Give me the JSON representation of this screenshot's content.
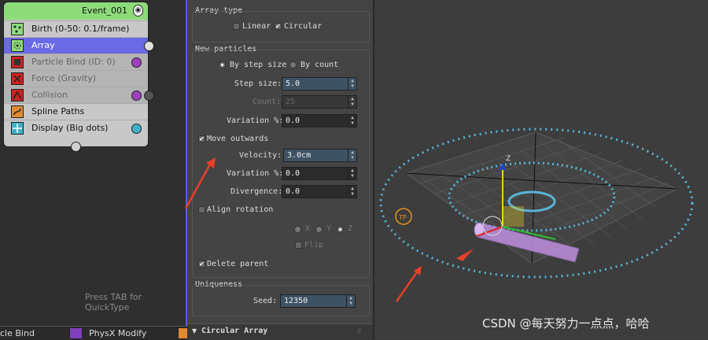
{
  "node": {
    "title": "Event_001",
    "rows": [
      {
        "label": "Birth (0-50: 0.1/frame)",
        "state": "normal",
        "pin": ""
      },
      {
        "label": "Array",
        "state": "selected",
        "pin": "#e0e0e0"
      },
      {
        "label": "Particle Bind (ID: 0)",
        "state": "disabled",
        "pin": "#a040c0"
      },
      {
        "label": "Force (Gravity)",
        "state": "disabled",
        "pin": ""
      },
      {
        "label": "Collision",
        "state": "disabled",
        "pin": "#a040c0"
      },
      {
        "label": "Spline Paths",
        "state": "normal",
        "pin": ""
      },
      {
        "label": "Display (Big dots)",
        "state": "normal",
        "pin": "#40b0c8"
      }
    ]
  },
  "graph": {
    "hint": "Press TAB for QuickType"
  },
  "bottombar": {
    "items": [
      "cle Bind",
      "PhysX Modify"
    ]
  },
  "panel": {
    "array_type": {
      "title": "Array type",
      "linear_label": "Linear",
      "linear_checked": false,
      "circular_label": "Circular",
      "circular_checked": true
    },
    "new_particles": {
      "title": "New particles",
      "by_step_size_label": "By step size",
      "by_count_label": "By count",
      "step_size_label": "Step size:",
      "step_size_value": "5.0",
      "count_label": "Count:",
      "count_value": "25",
      "variation1_label": "Variation %:",
      "variation1_value": "0.0",
      "move_outwards_label": "Move outwards",
      "move_outwards_checked": true,
      "velocity_label": "Velocity:",
      "velocity_value": "3.0cm",
      "variation2_label": "Variation %:",
      "variation2_value": "0.0",
      "divergence_label": "Divergence:",
      "divergence_value": "0.0",
      "align_rotation_label": "Align rotation",
      "align_rotation_checked": false,
      "axis_x": "X",
      "axis_y": "Y",
      "axis_z": "Z",
      "flip_label": "Flip",
      "delete_parent_label": "Delete parent",
      "delete_parent_checked": true
    },
    "uniqueness": {
      "title": "Uniqueness",
      "seed_label": "Seed:",
      "seed_value": "12350"
    },
    "rollout_title": "Circular Array"
  },
  "viewport": {
    "gizmo_label": "Z",
    "watermark": "CSDN @每天努力一点点，哈哈",
    "colors": {
      "dots": "#5ab4d8",
      "arrow": "#e8402a",
      "tube": "#c090e0",
      "gizmo_yellow": "#e8d020"
    }
  },
  "icons": {
    "birth": "birth-icon",
    "array": "array-icon",
    "bind": "bind-icon",
    "force": "force-icon",
    "collision": "collision-icon",
    "spline": "spline-icon",
    "display": "display-icon"
  }
}
